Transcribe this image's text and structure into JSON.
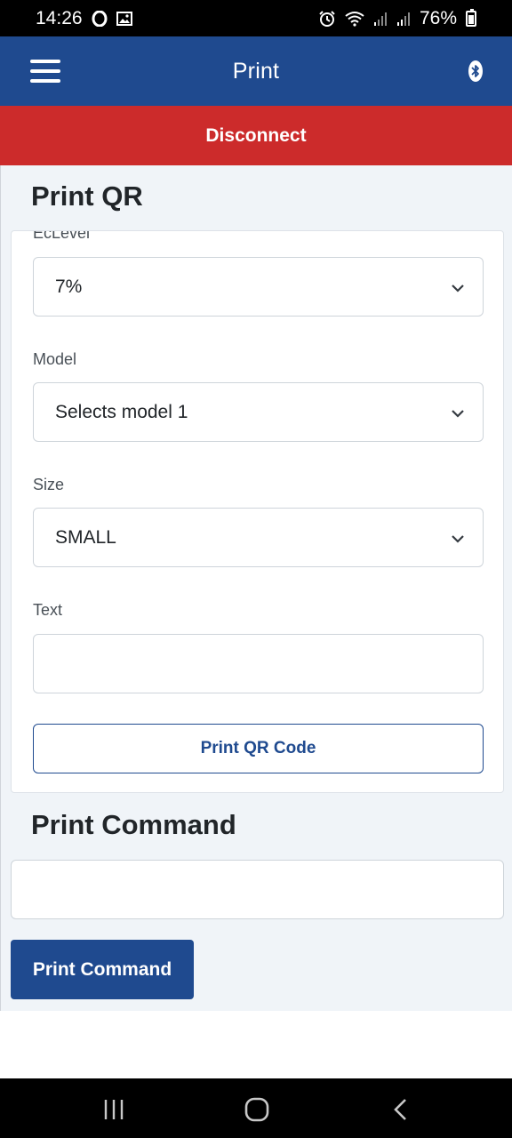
{
  "status_bar": {
    "time": "14:26",
    "battery_percent": "76%"
  },
  "app_bar": {
    "title": "Print"
  },
  "disconnect_label": "Disconnect",
  "print_qr": {
    "title": "Print QR",
    "ec_level": {
      "label": "EcLevel",
      "value": "7%"
    },
    "model": {
      "label": "Model",
      "value": "Selects model 1"
    },
    "size": {
      "label": "Size",
      "value": "SMALL"
    },
    "text": {
      "label": "Text",
      "value": ""
    },
    "button_label": "Print QR Code"
  },
  "print_command": {
    "title": "Print Command",
    "input_value": "",
    "button_label": "Print Command"
  },
  "colors": {
    "primary": "#1f4a8f",
    "danger": "#cc2b2b",
    "background": "#f0f4f8"
  }
}
